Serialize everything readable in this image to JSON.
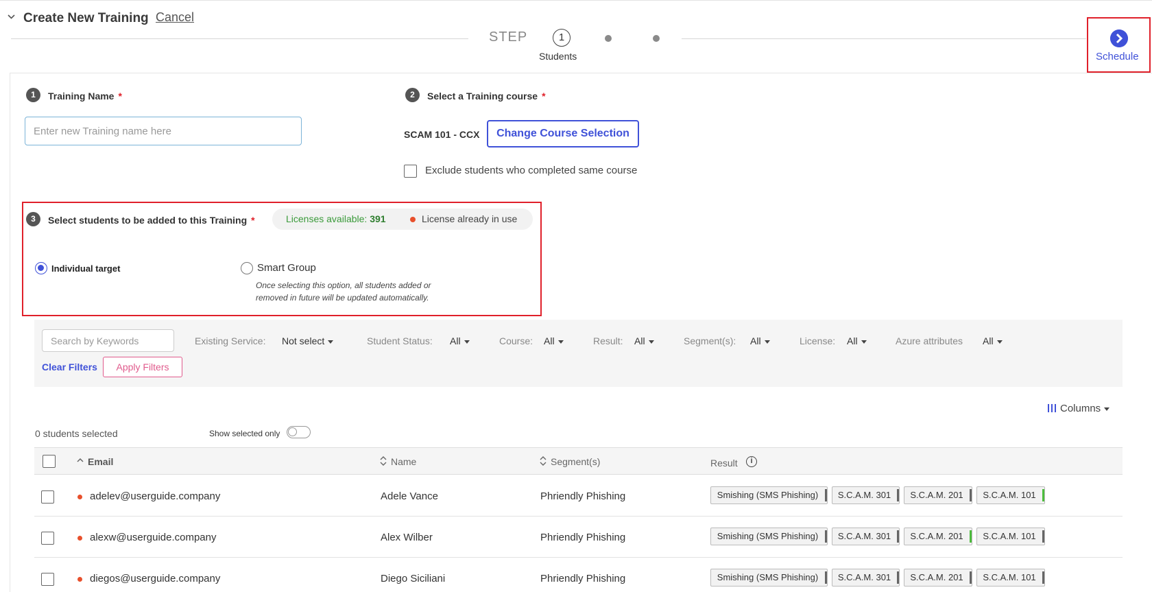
{
  "header": {
    "title": "Create New Training",
    "cancel": "Cancel",
    "step_label": "STEP",
    "step_number": "1",
    "step_name": "Students",
    "schedule": "Schedule"
  },
  "training_name": {
    "num": "1",
    "label": "Training Name",
    "required": "*",
    "placeholder": "Enter new Training name here"
  },
  "course": {
    "num": "2",
    "label": "Select a Training course",
    "required": "*",
    "code": "SCAM 101 - CCX",
    "change_button": "Change Course Selection",
    "exclude_label": "Exclude students who completed same course"
  },
  "students": {
    "num": "3",
    "label": "Select students to be added to this Training",
    "required": "*",
    "licenses_label": "Licenses available:",
    "licenses_value": "391",
    "license_in_use": "License already in use",
    "individual": "Individual target",
    "smart_group": "Smart Group",
    "smart_desc": "Once selecting this option, all students added or removed in future will be updated automatically."
  },
  "filters": {
    "search_placeholder": "Search by Keywords",
    "items": [
      {
        "label": "Existing Service:",
        "value": "Not select"
      },
      {
        "label": "Student Status:",
        "value": "All"
      },
      {
        "label": "Course:",
        "value": "All"
      },
      {
        "label": "Result:",
        "value": "All"
      },
      {
        "label": "Segment(s):",
        "value": "All"
      },
      {
        "label": "License:",
        "value": "All"
      },
      {
        "label": "Azure attributes",
        "value": "All"
      }
    ],
    "clear": "Clear Filters",
    "apply": "Apply Filters"
  },
  "table": {
    "columns_button": "Columns",
    "selected_count": "0 students selected",
    "show_selected": "Show selected only",
    "headers": {
      "email": "Email",
      "name": "Name",
      "segment": "Segment(s)",
      "result": "Result",
      "info": "i"
    },
    "rows": [
      {
        "email": "adelev@userguide.company",
        "name": "Adele Vance",
        "segment": "Phriendly Phishing",
        "badges": [
          {
            "label": "Smishing (SMS Phishing)",
            "mark": "gray"
          },
          {
            "label": "S.C.A.M. 301",
            "mark": "gray"
          },
          {
            "label": "S.C.A.M. 201",
            "mark": "gray"
          },
          {
            "label": "S.C.A.M. 101",
            "mark": "green"
          }
        ]
      },
      {
        "email": "alexw@userguide.company",
        "name": "Alex Wilber",
        "segment": "Phriendly Phishing",
        "badges": [
          {
            "label": "Smishing (SMS Phishing)",
            "mark": "gray"
          },
          {
            "label": "S.C.A.M. 301",
            "mark": "gray"
          },
          {
            "label": "S.C.A.M. 201",
            "mark": "green"
          },
          {
            "label": "S.C.A.M. 101",
            "mark": "gray"
          }
        ]
      },
      {
        "email": "diegos@userguide.company",
        "name": "Diego Siciliani",
        "segment": "Phriendly Phishing",
        "badges": [
          {
            "label": "Smishing (SMS Phishing)",
            "mark": "gray"
          },
          {
            "label": "S.C.A.M. 301",
            "mark": "gray"
          },
          {
            "label": "S.C.A.M. 201",
            "mark": "gray"
          },
          {
            "label": "S.C.A.M. 101",
            "mark": "gray"
          }
        ]
      }
    ]
  },
  "colors": {
    "accent": "#3f51d8",
    "highlight": "#e0202a",
    "status_dot": "#e8502c",
    "pass": "#4cbc3c",
    "apply": "#e05a8c"
  }
}
